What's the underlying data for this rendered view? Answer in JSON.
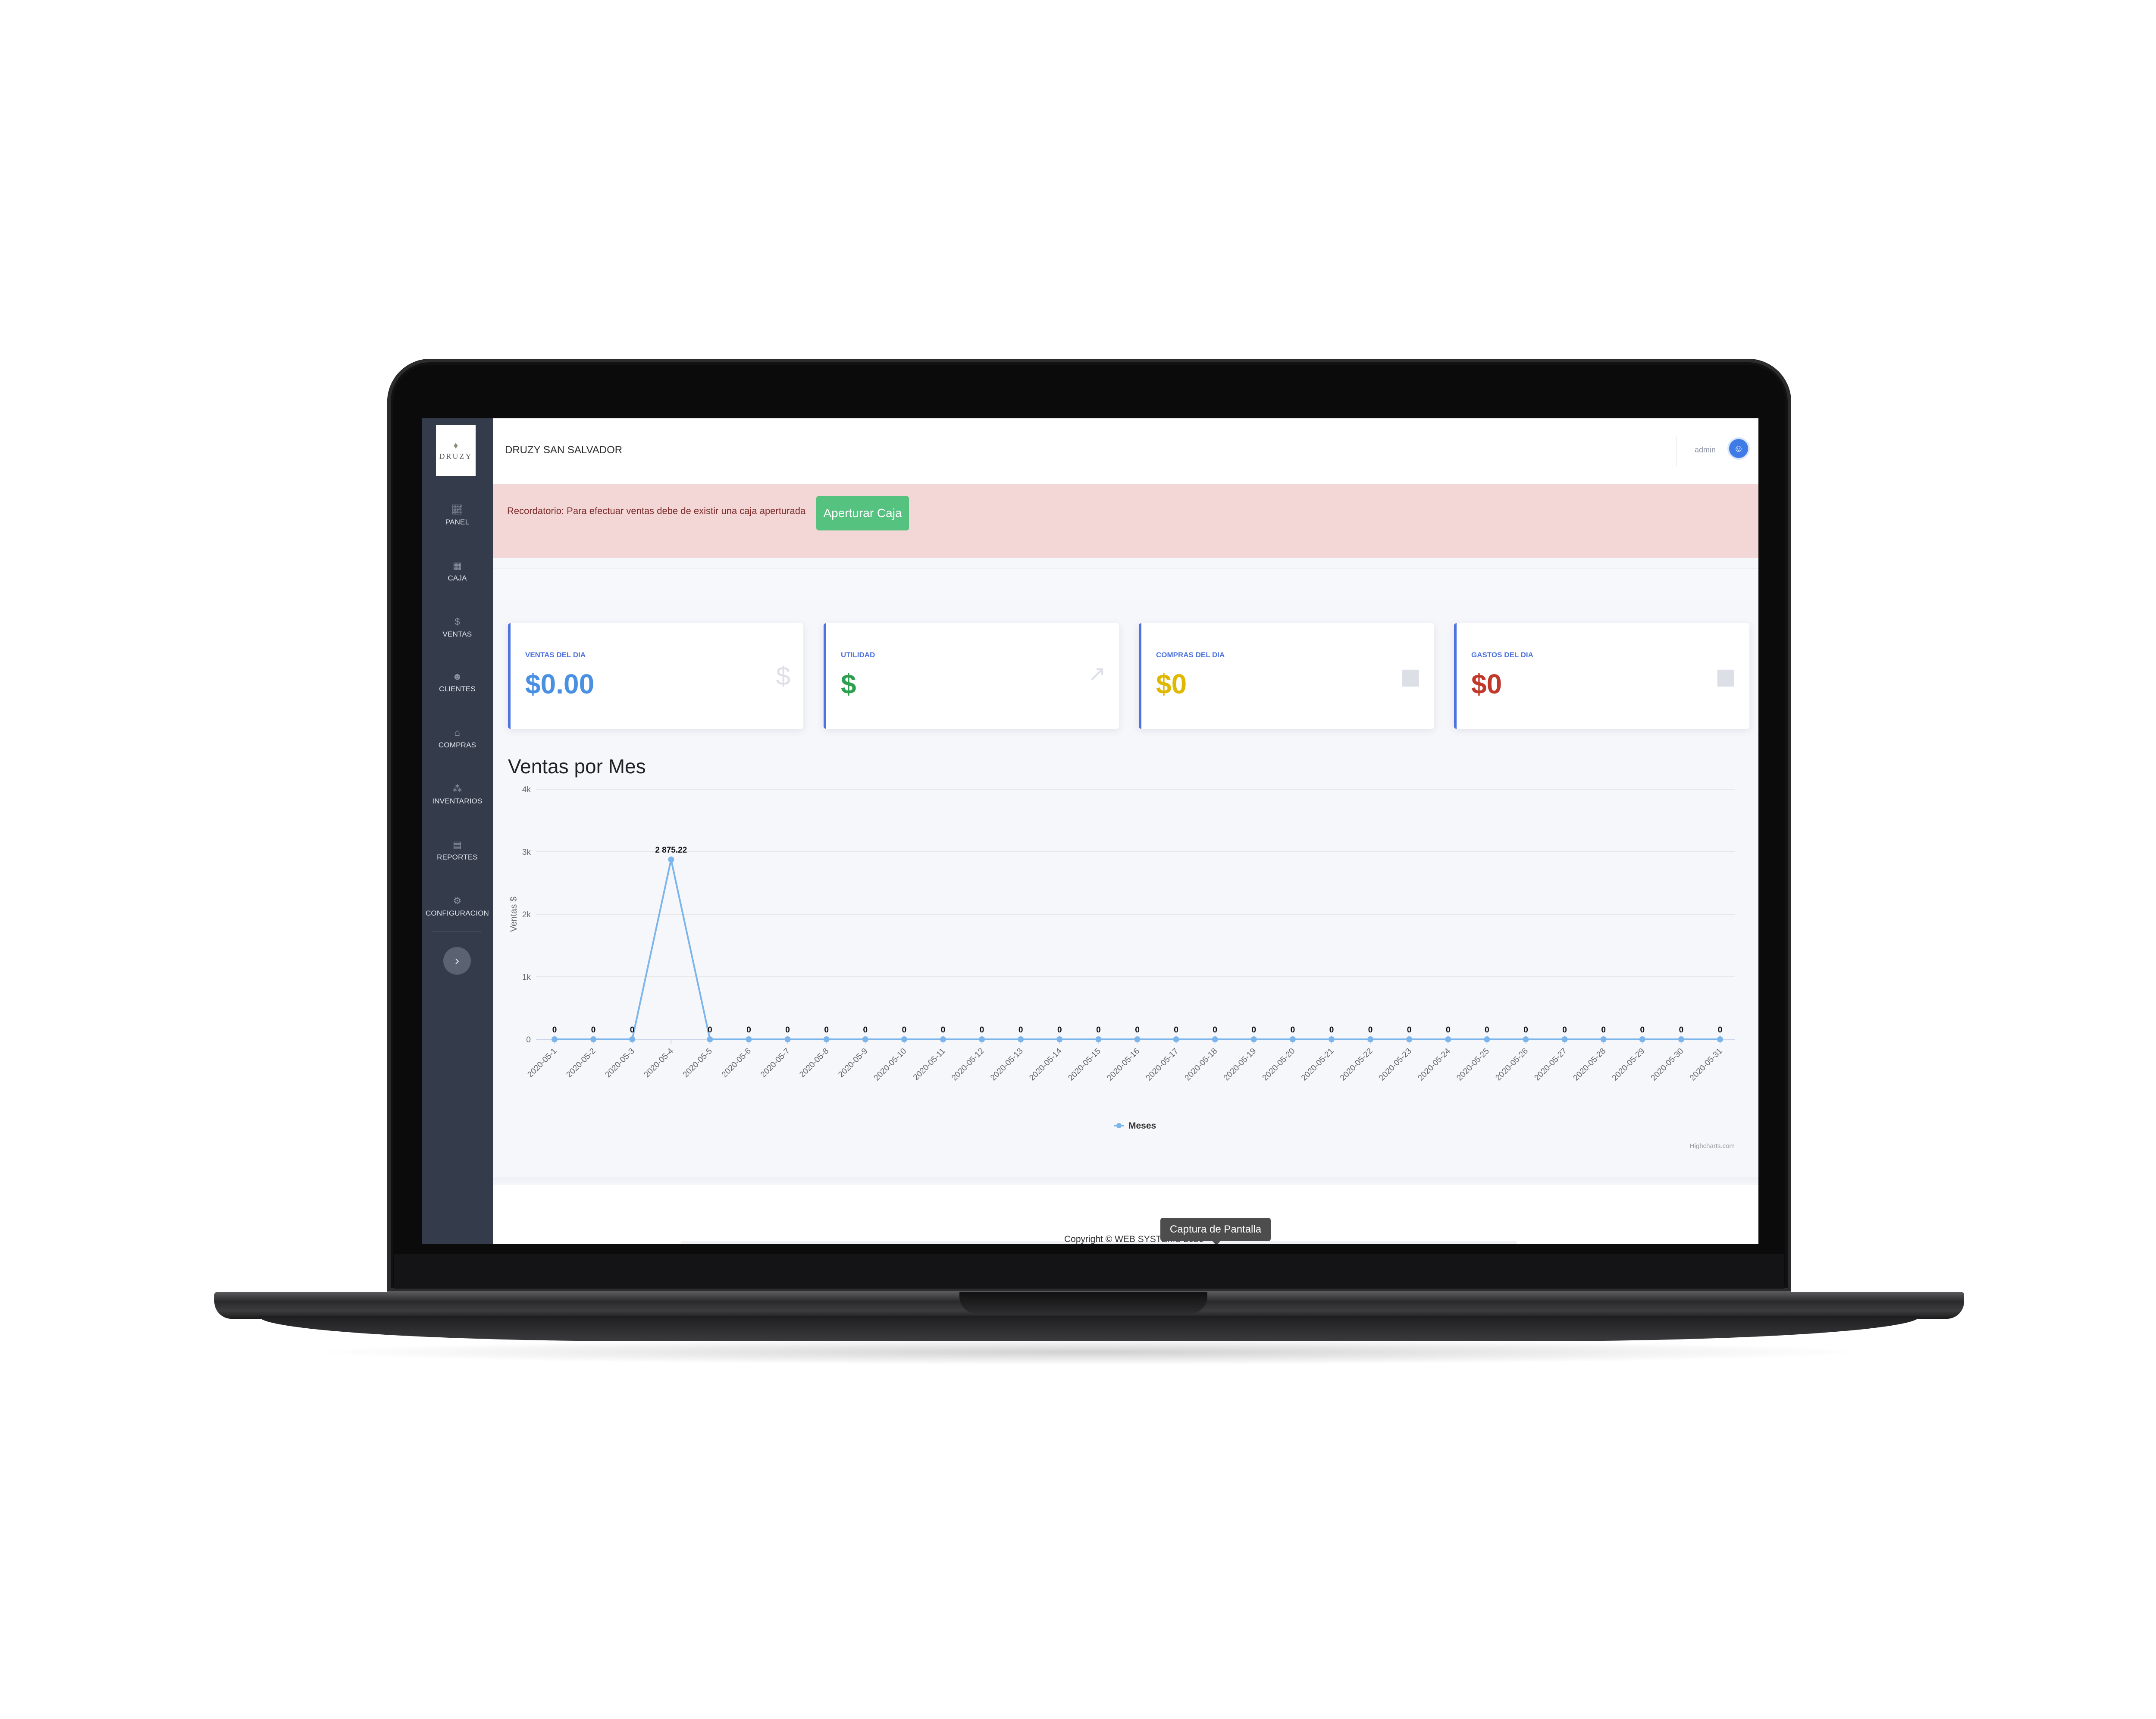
{
  "app": {
    "brand_title": "DRUZY SAN SALVADOR",
    "logo_text": "DRUZY",
    "user_name": "admin"
  },
  "sidebar": {
    "items": [
      {
        "label": "PANEL",
        "icon": "chart-icon"
      },
      {
        "label": "CAJA",
        "icon": "register-icon"
      },
      {
        "label": "VENTAS",
        "icon": "dollar-icon"
      },
      {
        "label": "CLIENTES",
        "icon": "users-icon"
      },
      {
        "label": "COMPRAS",
        "icon": "basket-icon"
      },
      {
        "label": "INVENTARIOS",
        "icon": "boxes-icon"
      },
      {
        "label": "REPORTES",
        "icon": "report-icon"
      },
      {
        "label": "CONFIGURACION",
        "icon": "cogs-icon"
      }
    ],
    "collapse_label": "›"
  },
  "alert": {
    "text": "Recordatorio: Para efectuar ventas debe de existir una caja aperturada",
    "button_label": "Aperturar Caja"
  },
  "cards": [
    {
      "label": "VENTAS DEL DIA",
      "value": "$0.00",
      "color": "#4a90e2",
      "icon": "dollar-icon"
    },
    {
      "label": "UTILIDAD",
      "value": "$",
      "color": "#2e9e4f",
      "icon": "chart-line-icon"
    },
    {
      "label": "COMPRAS DEL DIA",
      "value": "$0",
      "color": "#e0b800",
      "icon": "bag-icon"
    },
    {
      "label": "GASTOS DEL DIA",
      "value": "$0",
      "color": "#c0392b",
      "icon": "bag-icon"
    }
  ],
  "chart_title": "Ventas por Mes",
  "chart_data": {
    "type": "line",
    "title": "Ventas por Mes",
    "ylabel": "Ventas $",
    "xlabel": "",
    "ylim": [
      0,
      4000
    ],
    "yticks": [
      "0",
      "1k",
      "2k",
      "3k",
      "4k"
    ],
    "categories": [
      "2020-05-1",
      "2020-05-2",
      "2020-05-3",
      "2020-05-4",
      "2020-05-5",
      "2020-05-6",
      "2020-05-7",
      "2020-05-8",
      "2020-05-9",
      "2020-05-10",
      "2020-05-11",
      "2020-05-12",
      "2020-05-13",
      "2020-05-14",
      "2020-05-15",
      "2020-05-16",
      "2020-05-17",
      "2020-05-18",
      "2020-05-19",
      "2020-05-20",
      "2020-05-21",
      "2020-05-22",
      "2020-05-23",
      "2020-05-24",
      "2020-05-25",
      "2020-05-26",
      "2020-05-27",
      "2020-05-28",
      "2020-05-29",
      "2020-05-30",
      "2020-05-31"
    ],
    "series": [
      {
        "name": "Meses",
        "values": [
          0,
          0,
          0,
          2875.22,
          0,
          0,
          0,
          0,
          0,
          0,
          0,
          0,
          0,
          0,
          0,
          0,
          0,
          0,
          0,
          0,
          0,
          0,
          0,
          0,
          0,
          0,
          0,
          0,
          0,
          0,
          0
        ],
        "labels": [
          "0",
          "0",
          "0",
          "2 875.22",
          "0",
          "0",
          "0",
          "0",
          "0",
          "0",
          "0",
          "0",
          "0",
          "0",
          "0",
          "0",
          "0",
          "0",
          "0",
          "0",
          "0",
          "0",
          "0",
          "0",
          "0",
          "0",
          "0",
          "0",
          "0",
          "0",
          "0"
        ]
      }
    ],
    "legend": "bottom-center",
    "grid": true,
    "credit": "Highcharts.com",
    "line_color": "#7cb5ec"
  },
  "footer": {
    "text": "Copyright © WEB SYSTEMS 2020",
    "tooltip": "Captura de Pantalla"
  }
}
